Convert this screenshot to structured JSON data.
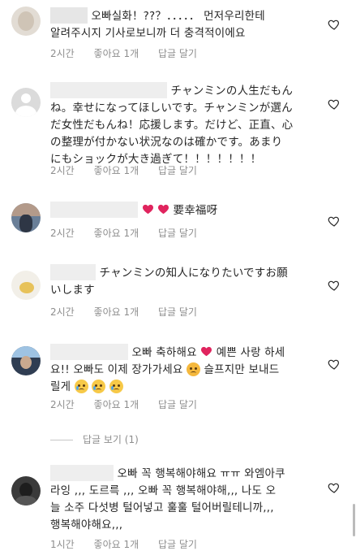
{
  "comments": [
    {
      "line1": "오빠실화！??？．．．．． 먼저우리한테",
      "line2": "알려주시지 기사로보니까 더 충격적이에요",
      "time": "2시간",
      "likes": "좋아요 1개",
      "reply": "답글 달기"
    },
    {
      "line1": "チャンミンの人生だもん",
      "line2": "ね。幸せになってほしいです。チャンミンが選ん",
      "line3": "だ女性だもんね！応援します。だけど、正直、心",
      "line4": "の整理が付かない状況なのは確かです。あまり",
      "line5": "にもショックが大き過ぎて！！！！！！！",
      "time": "2시간",
      "likes": "좋아요 1개",
      "reply": "답글 달기"
    },
    {
      "line1": "要幸福呀",
      "time": "2시간",
      "likes": "좋아요 1개",
      "reply": "답글 달기"
    },
    {
      "line1": "チャンミンの知人になりたいですお願",
      "line2": "いします",
      "time": "2시간",
      "likes": "좋아요 1개",
      "reply": "답글 달기"
    },
    {
      "line1": "오빠 축하해요",
      "line1b": "예쁜 사랑 하세",
      "line2": "요!! 오빠도 이제 장가가세요",
      "line2b": "슬프지만 보내드",
      "line3": "릴게",
      "time": "2시간",
      "likes": "좋아요 1개",
      "reply": "답글 달기"
    },
    {
      "line1": "오빠 꼭 행복해야해요 ㅠㅠ 와엠아쿠",
      "line2": "라잉 ,,, 도르륵 ,,, 오빠 꼭 행복해야해,,, 나도 오",
      "line3": "늘 소주 다섯병 털어넣고 훌훌 털어버릴테니까,,,",
      "line4": "행복해야해요,,,",
      "time": "1시간",
      "likes": "좋아요 1개",
      "reply": "답글 달기"
    }
  ],
  "view_replies": "답글 보기 (1)",
  "icons": {
    "like": "heart-outline-icon"
  },
  "colors": {
    "text": "#262626",
    "meta": "#8e8e8e",
    "heart_red": "#e0245e"
  }
}
